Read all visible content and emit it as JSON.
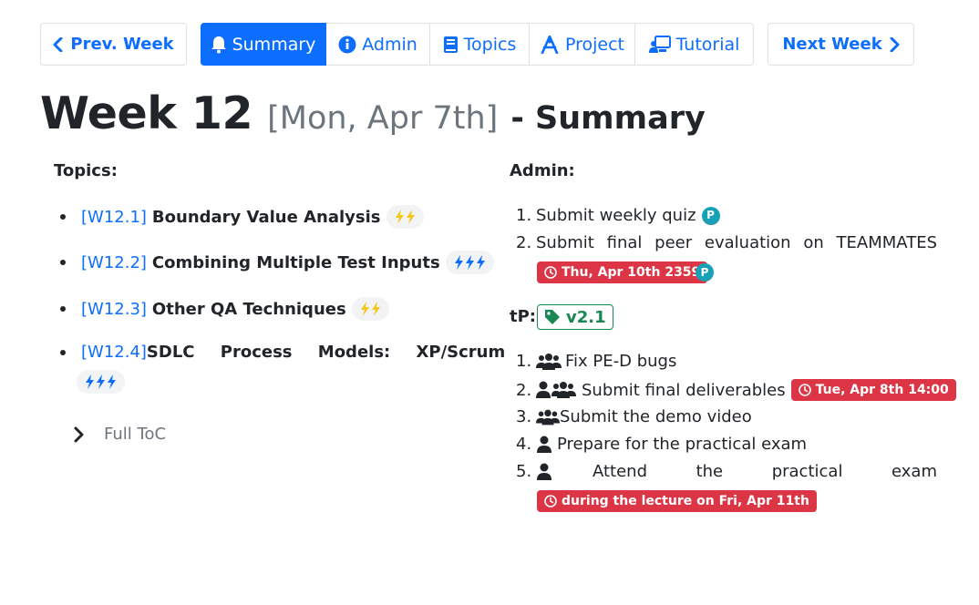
{
  "nav": {
    "prev_label": "Prev. Week",
    "next_label": "Next Week",
    "tabs": [
      {
        "label": "Summary",
        "icon": "bell-icon",
        "active": true
      },
      {
        "label": "Admin",
        "icon": "info-icon",
        "active": false
      },
      {
        "label": "Topics",
        "icon": "book-icon",
        "active": false
      },
      {
        "label": "Project",
        "icon": "project-icon",
        "active": false
      },
      {
        "label": "Tutorial",
        "icon": "tutorial-icon",
        "active": false
      }
    ]
  },
  "heading": {
    "week": "Week 12",
    "date": "[Mon, Apr 7th]",
    "suffix": "- Summary"
  },
  "topics": {
    "title": "Topics:",
    "items": [
      {
        "id": "[W12.1]",
        "name": "Boundary Value Analysis",
        "bolts": 2
      },
      {
        "id": "[W12.2]",
        "name": "Combining Multiple Test Inputs",
        "bolts": 3
      },
      {
        "id": "[W12.3]",
        "name": "Other QA Techniques",
        "bolts": 2
      },
      {
        "id": "[W12.4]",
        "name": "SDLC Process Models: XP/Scrum",
        "bolts": 3
      }
    ],
    "toc_label": "Full ToC"
  },
  "admin": {
    "title": "Admin:",
    "items": [
      {
        "num": "1.",
        "text": "Submit weekly quiz",
        "badge": "P"
      },
      {
        "num": "2.",
        "text": "Submit final peer evaluation on TEAMMATES",
        "deadline": "Thu, Apr 10th 2359",
        "badge": "P"
      }
    ]
  },
  "tp": {
    "label": "tP:",
    "version": "v2.1",
    "items": [
      {
        "num": "1.",
        "text": "Fix PE-D bugs",
        "icon": "team-icon"
      },
      {
        "num": "2.",
        "text": "Submit final deliverables",
        "icon": "person-team-icon",
        "deadline": "Tue, Apr 8th 14:00"
      },
      {
        "num": "3.",
        "text": "Submit the demo video",
        "icon": "team-icon"
      },
      {
        "num": "4.",
        "text": "Prepare for the practical exam",
        "icon": "person-icon"
      },
      {
        "num": "5.",
        "text": "Attend the practical exam",
        "icon": "person-icon",
        "deadline": "during the lecture on Fri, Apr 11th"
      }
    ]
  },
  "colors": {
    "primary": "#0d6efd",
    "danger": "#dc3545",
    "success": "#198754",
    "info": "#17a2b8",
    "muted": "#6c757d",
    "bolt_yellow": "#f5c518"
  }
}
